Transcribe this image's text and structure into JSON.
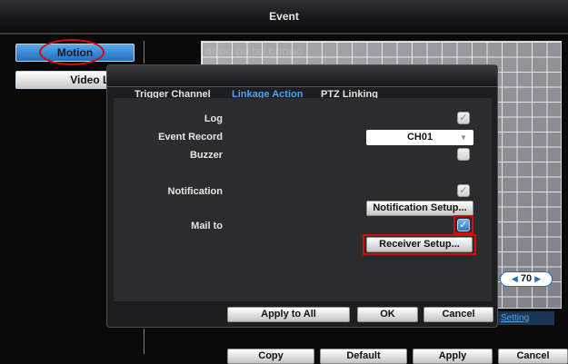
{
  "window": {
    "title": "Event"
  },
  "sidebar": {
    "items": [
      {
        "label": "Motion"
      },
      {
        "label": "Video Loss"
      }
    ]
  },
  "dialog": {
    "tabs": [
      {
        "label": "Trigger Channel"
      },
      {
        "label": "Linkage Action"
      },
      {
        "label": "PTZ Linking"
      }
    ],
    "rows": {
      "log": {
        "label": "Log",
        "checked": true
      },
      "event_record": {
        "label": "Event Record",
        "value": "CH01"
      },
      "buzzer": {
        "label": "Buzzer",
        "checked": false
      },
      "notification": {
        "label": "Notification",
        "checked": true,
        "setup_label": "Notification Setup..."
      },
      "mail_to": {
        "label": "Mail to",
        "checked": true,
        "setup_label": "Receiver Setup..."
      }
    },
    "buttons": {
      "apply_all": "Apply to All",
      "ok": "OK",
      "cancel": "Cancel"
    }
  },
  "sensitivity": {
    "value": "70"
  },
  "setting_link": "Setting",
  "footer": {
    "copy": "Copy",
    "default": "Default",
    "apply": "Apply",
    "cancel": "Cancel"
  },
  "icons": {
    "check": "✓",
    "dropdown": "▼",
    "left": "◀",
    "right": "▶"
  },
  "colors": {
    "accent_blue": "#2a78c8",
    "highlight_red": "#d40b0b"
  }
}
